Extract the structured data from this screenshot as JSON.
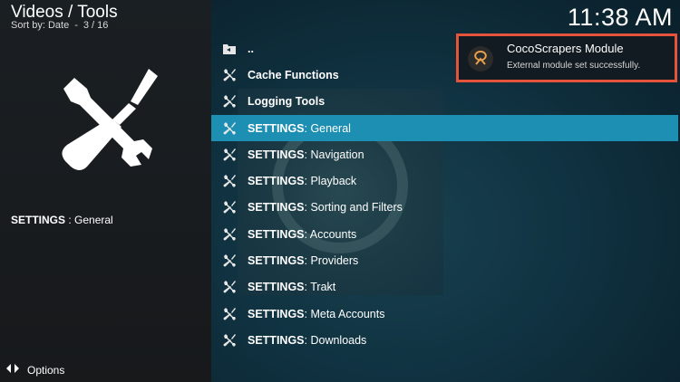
{
  "header": {
    "title": "Videos / Tools",
    "sort_label": "Sort by: Date",
    "position": "3 / 16"
  },
  "clock": "11:38 AM",
  "left_panel": {
    "selected_caption_strong": "SETTINGS",
    "selected_caption_rest": " : General",
    "hero_icon": "tools-icon"
  },
  "footer": {
    "options_label": "Options",
    "options_icon": "options-arrows-icon"
  },
  "list": {
    "items": [
      {
        "strong": "..",
        "rest": "",
        "icon": "folder-back-icon"
      },
      {
        "strong": "Cache Functions",
        "rest": "",
        "icon": "tools-icon"
      },
      {
        "strong": "Logging Tools",
        "rest": "",
        "icon": "tools-icon"
      },
      {
        "strong": "SETTINGS",
        "rest": " : General",
        "icon": "tools-icon"
      },
      {
        "strong": "SETTINGS",
        "rest": " : Navigation",
        "icon": "tools-icon"
      },
      {
        "strong": "SETTINGS",
        "rest": " : Playback",
        "icon": "tools-icon"
      },
      {
        "strong": "SETTINGS",
        "rest": " : Sorting and Filters",
        "icon": "tools-icon"
      },
      {
        "strong": "SETTINGS",
        "rest": " : Accounts",
        "icon": "tools-icon"
      },
      {
        "strong": "SETTINGS",
        "rest": " : Providers",
        "icon": "tools-icon"
      },
      {
        "strong": "SETTINGS",
        "rest": " : Trakt",
        "icon": "tools-icon"
      },
      {
        "strong": "SETTINGS",
        "rest": " : Meta Accounts",
        "icon": "tools-icon"
      },
      {
        "strong": "SETTINGS",
        "rest": " : Downloads",
        "icon": "tools-icon"
      }
    ],
    "selected_index": 3
  },
  "notification": {
    "title": "CocoScrapers Module",
    "message": "External module set successfully.",
    "icon": "cocoscrapers-logo-icon"
  },
  "colors": {
    "selection": "#1d8fb3",
    "notification_border": "#e5533a",
    "left_panel_bg": "#1a1f23",
    "right_panel_bg": "#103241"
  }
}
